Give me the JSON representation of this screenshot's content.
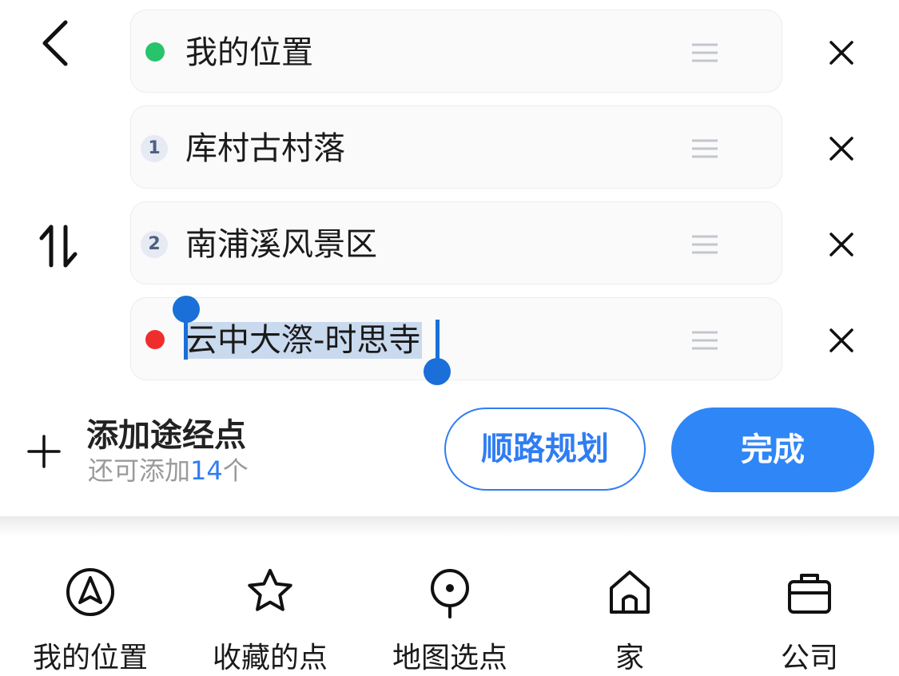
{
  "route": {
    "stops": [
      {
        "label": "我的位置",
        "marker": "dot",
        "color": "#27c46b"
      },
      {
        "label": "库村古村落",
        "marker": "number",
        "number": "1"
      },
      {
        "label": "南浦溪风景区",
        "marker": "number",
        "number": "2"
      },
      {
        "label": "云中大漈-时思寺",
        "marker": "dot",
        "color": "#f02d2d",
        "selected": true
      }
    ]
  },
  "add_waypoint": {
    "title": "添加途经点",
    "sub_prefix": "还可添加",
    "count": "14",
    "sub_suffix": "个"
  },
  "buttons": {
    "route_label": "顺路规划",
    "done_label": "完成"
  },
  "nav": {
    "items": [
      {
        "label": "我的位置",
        "icon": "navigation-arrow-icon"
      },
      {
        "label": "收藏的点",
        "icon": "star-icon"
      },
      {
        "label": "地图选点",
        "icon": "map-pin-icon"
      },
      {
        "label": "家",
        "icon": "home-icon"
      },
      {
        "label": "公司",
        "icon": "briefcase-icon"
      }
    ]
  },
  "colors": {
    "accent": "#2f7df3",
    "selection": "#c9d9ee",
    "cursor": "#1a6fd8"
  }
}
